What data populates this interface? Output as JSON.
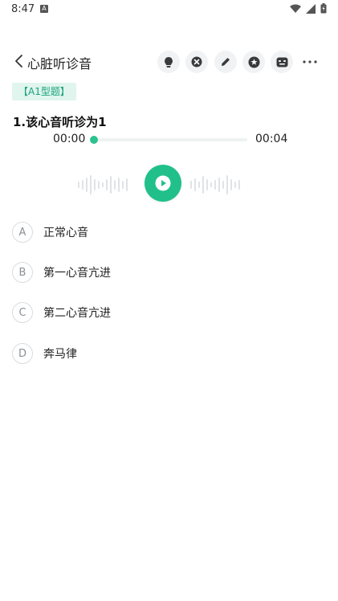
{
  "status_bar": {
    "time": "8:47",
    "a_badge": "A"
  },
  "nav": {
    "title": "心脏听诊音",
    "icons": [
      "bulb-icon",
      "close-circle-icon",
      "edit-icon",
      "star-icon",
      "notes-icon",
      "more-icon"
    ]
  },
  "question_type": "【A1型题】",
  "question": "1.该心音听诊为1",
  "player": {
    "current": "00:00",
    "duration": "00:04",
    "progress": 0
  },
  "options": [
    {
      "letter": "A",
      "text": "正常心音"
    },
    {
      "letter": "B",
      "text": "第一心音亢进"
    },
    {
      "letter": "C",
      "text": "第二心音亢进"
    },
    {
      "letter": "D",
      "text": "奔马律"
    }
  ],
  "colors": {
    "accent": "#21c08b",
    "tag_bg": "#dff5ee",
    "tag_text": "#1aa37a"
  }
}
